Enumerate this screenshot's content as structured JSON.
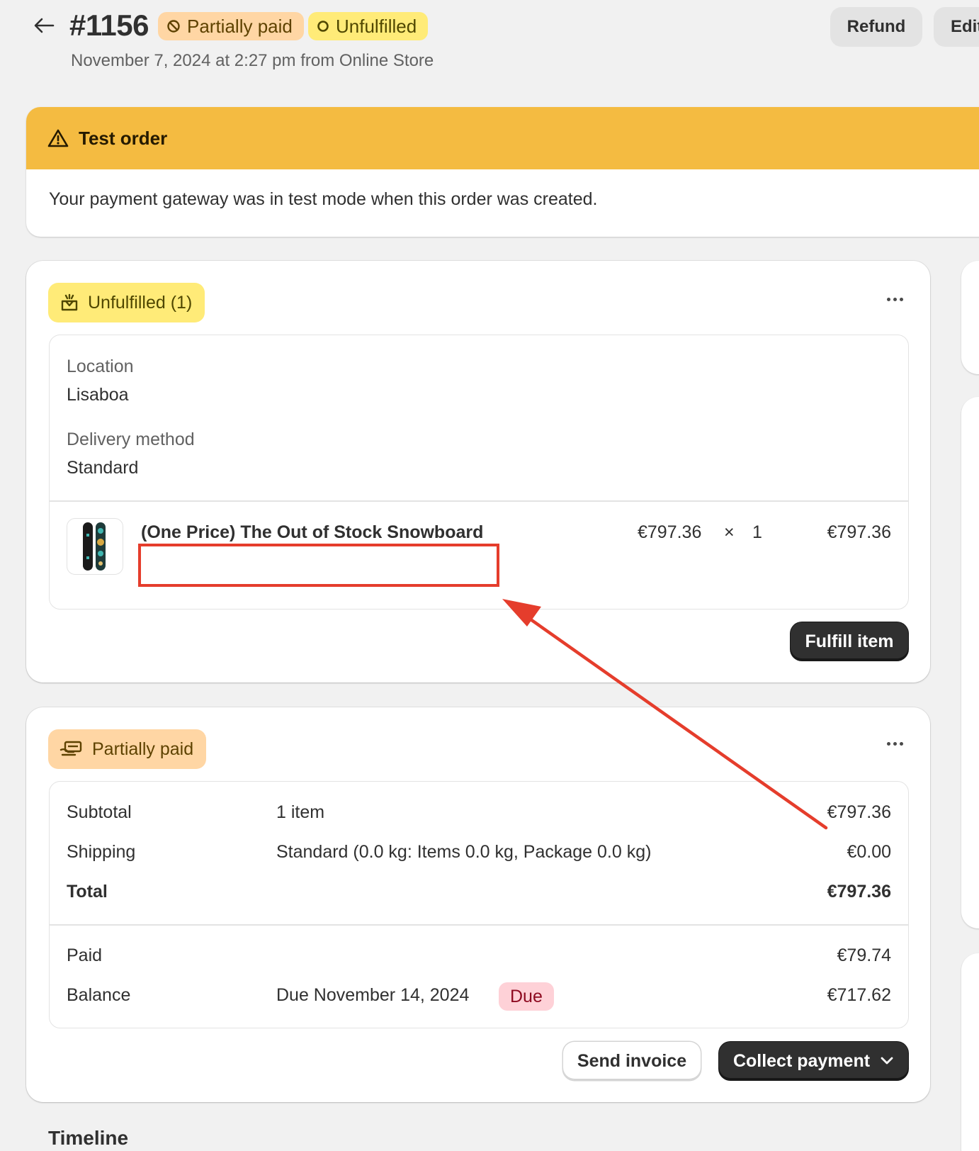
{
  "header": {
    "order_number": "#1156",
    "payment_badge": "Partially paid",
    "fulfillment_badge": "Unfulfilled",
    "subtitle": "November 7, 2024 at 2:27 pm from Online Store",
    "refund_label": "Refund",
    "edit_label": "Edit"
  },
  "banner": {
    "title": "Test order",
    "message": "Your payment gateway was in test mode when this order was created.",
    "color": "#f4bb41"
  },
  "fulfillment_card": {
    "status_label": "Unfulfilled (1)",
    "location_label": "Location",
    "location_value": "Lisaboa",
    "delivery_label": "Delivery method",
    "delivery_value": "Standard",
    "line_item": {
      "title": "(One Price) The Out of Stock Snowboard",
      "unit_price": "€797.36",
      "times": "×",
      "quantity": "1",
      "total": "€797.36"
    },
    "fulfill_button": "Fulfill item"
  },
  "payment_card": {
    "status_label": "Partially paid",
    "rows": [
      {
        "label": "Subtotal",
        "detail": "1 item",
        "amount": "€797.36"
      },
      {
        "label": "Shipping",
        "detail": "Standard (0.0 kg: Items 0.0 kg, Package 0.0 kg)",
        "amount": "€0.00"
      },
      {
        "label": "Total",
        "detail": "",
        "amount": "€797.36"
      }
    ],
    "paid_label": "Paid",
    "paid_amount": "€79.74",
    "balance_label": "Balance",
    "balance_detail": "Due November 14, 2024",
    "due_badge": "Due",
    "balance_amount": "€717.62",
    "send_invoice": "Send invoice",
    "collect_payment": "Collect payment"
  },
  "timeline": {
    "title": "Timeline"
  },
  "annotation": {
    "color": "#e53d2c"
  },
  "icons": [
    "arrow-left-icon",
    "payment-pending-icon",
    "circle-outline-icon",
    "alert-triangle-icon",
    "fulfillment-icon",
    "cash-icon",
    "more-dots-icon",
    "chevron-down-icon",
    "snowboard-thumbnail"
  ]
}
